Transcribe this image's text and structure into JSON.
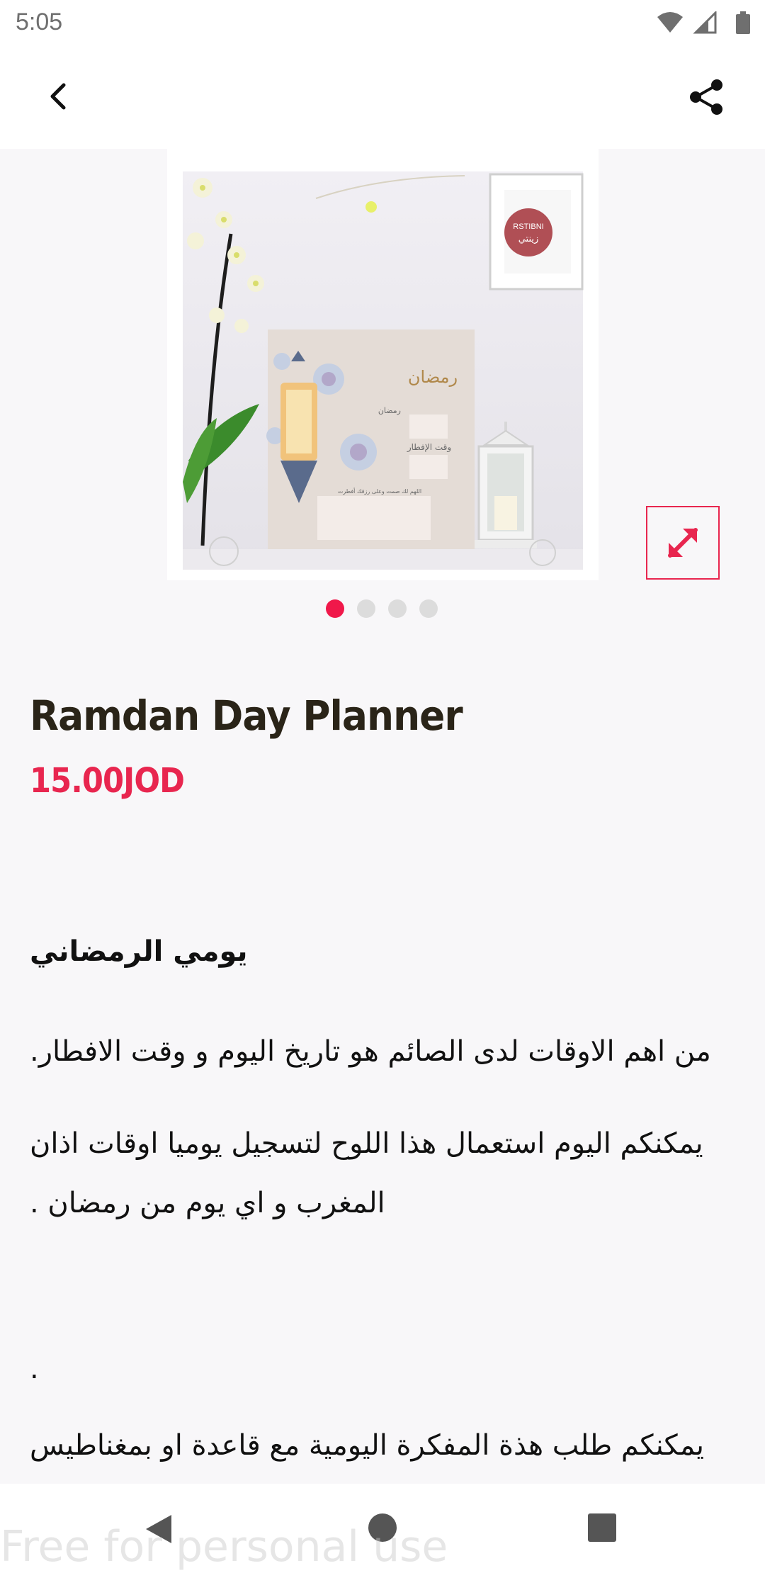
{
  "status_bar": {
    "time": "5:05",
    "icons": [
      "wifi-icon",
      "cell-signal-icon",
      "battery-icon"
    ]
  },
  "app_bar": {
    "back_icon": "chevron-left-icon",
    "share_icon": "share-icon"
  },
  "gallery": {
    "image_logo_line1": "RSTIBNI",
    "image_logo_line2": "زينتي",
    "image_board_title": "رمضان",
    "image_board_label1": "رمضان",
    "image_board_label2": "وقت الإفطار",
    "image_board_label3": "اللهم لك صمت وعلى رزقك أفطرت",
    "page_count": 4,
    "active_page": 0,
    "expand_icon": "expand-icon"
  },
  "product": {
    "title": "Ramdan Day Planner",
    "price": "15.00JOD"
  },
  "description": {
    "heading": "يومي الرمضاني",
    "line1": "من اهم الاوقات لدى الصائم هو تاريخ اليوم و وقت الافطار.",
    "line2": "يمكنكم اليوم استعمال هذا اللوح لتسجيل يوميا اوقات اذان",
    "line3": "المغرب و اي يوم من رمضان .",
    "line4": ".",
    "line5": "يمكنكم طلب هذة المفكرة اليومية مع قاعدة او بمغناطيس"
  },
  "nav_bar": {
    "back_icon": "nav-back-icon",
    "home_icon": "nav-home-icon",
    "recents_icon": "nav-recents-icon"
  },
  "watermark": "Free for personal use",
  "colors": {
    "accent": "#e8264f",
    "background": "#f8f7f9",
    "title": "#2a2418"
  }
}
